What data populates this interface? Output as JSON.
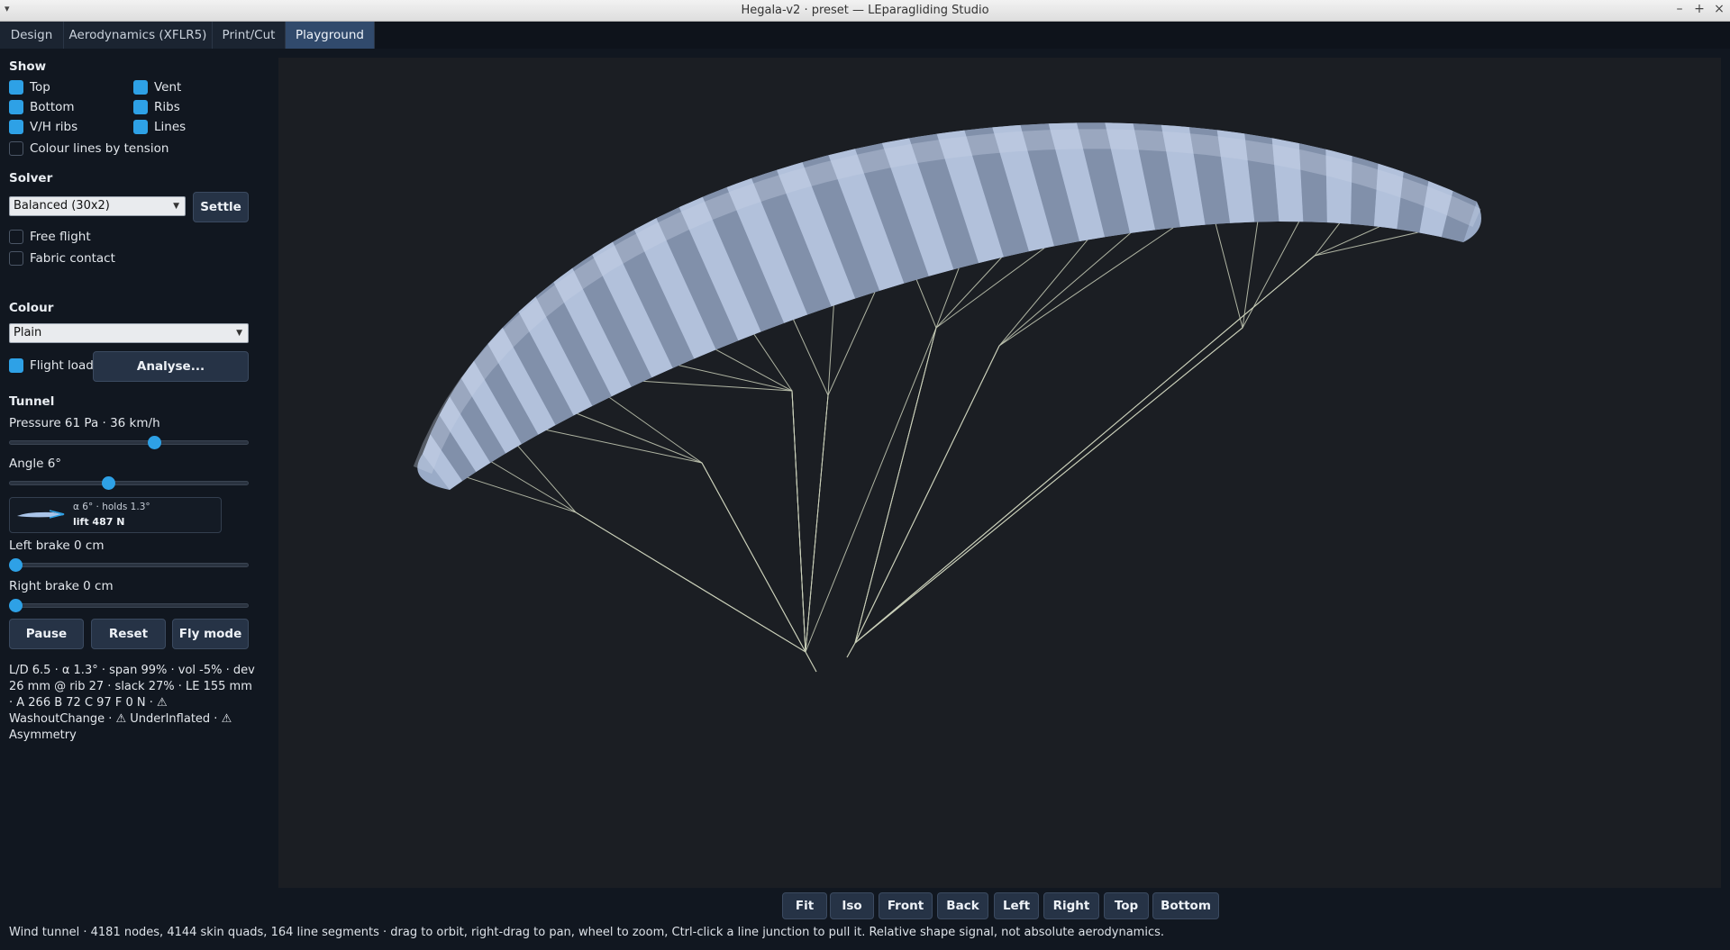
{
  "window": {
    "title": "Hegala-v2 · preset — LEparagliding Studio",
    "menu_glyph": "▾",
    "minimize_glyph": "–",
    "maximize_glyph": "+",
    "close_glyph": "×"
  },
  "tabs": [
    {
      "label": "Design",
      "active": false
    },
    {
      "label": "Aerodynamics (XFLR5)",
      "active": false
    },
    {
      "label": "Print/Cut",
      "active": false
    },
    {
      "label": "Playground",
      "active": true
    }
  ],
  "show": {
    "heading": "Show",
    "top": {
      "label": "Top",
      "checked": true
    },
    "vent": {
      "label": "Vent",
      "checked": true
    },
    "bottom": {
      "label": "Bottom",
      "checked": true
    },
    "ribs": {
      "label": "Ribs",
      "checked": true
    },
    "vh_ribs": {
      "label": "V/H ribs",
      "checked": true
    },
    "lines": {
      "label": "Lines",
      "checked": true
    },
    "colour_by_tension": {
      "label": "Colour lines by tension",
      "checked": false
    }
  },
  "solver": {
    "heading": "Solver",
    "mode_value": "Balanced (30x2)",
    "settle_label": "Settle",
    "free_flight": {
      "label": "Free flight",
      "checked": false
    },
    "fabric_contact": {
      "label": "Fabric contact",
      "checked": false
    }
  },
  "colour": {
    "heading": "Colour",
    "mode_value": "Plain",
    "flight_load": {
      "label": "Flight load",
      "checked": true
    },
    "analyse_label": "Analyse..."
  },
  "tunnel": {
    "heading": "Tunnel",
    "pressure_label": "Pressure 61 Pa · 36 km/h",
    "pressure_fraction": 0.61,
    "angle_label": "Angle 6°",
    "angle_fraction": 0.41,
    "wing_line1": "α 6° · holds 1.3°",
    "wing_line2": "lift 487 N",
    "left_brake_label": "Left brake 0 cm",
    "left_brake_fraction": 0,
    "right_brake_label": "Right brake 0 cm",
    "right_brake_fraction": 0,
    "pause_label": "Pause",
    "reset_label": "Reset",
    "fly_label": "Fly mode"
  },
  "stats_text": "L/D 6.5 · α 1.3° · span 99% · vol -5% · dev 26 mm @ rib 27 · slack 27% · LE 155 mm · A 266 B 72 C 97 F 0 N · ⚠ WashoutChange · ⚠ UnderInflated · ⚠ Asymmetry",
  "view_buttons": [
    {
      "key": "fit",
      "label": "Fit"
    },
    {
      "key": "iso",
      "label": "Iso"
    },
    {
      "key": "front",
      "label": "Front"
    },
    {
      "key": "back",
      "label": "Back"
    },
    {
      "key": "left",
      "label": "Left"
    },
    {
      "key": "right",
      "label": "Right"
    },
    {
      "key": "top",
      "label": "Top"
    },
    {
      "key": "bottom",
      "label": "Bottom"
    }
  ],
  "status_text": "Wind tunnel · 4181 nodes, 4144 skin quads, 164 line segments · drag to orbit, right-drag to pan, wheel to zoom, Ctrl-click a line junction to pull it. Relative shape signal, not absolute aerodynamics.",
  "colors": {
    "accent": "#2ea1e6",
    "canopy": "#a9b9d6",
    "lines": "#c9cfb8",
    "viewport_bg": "#1b1e23"
  }
}
